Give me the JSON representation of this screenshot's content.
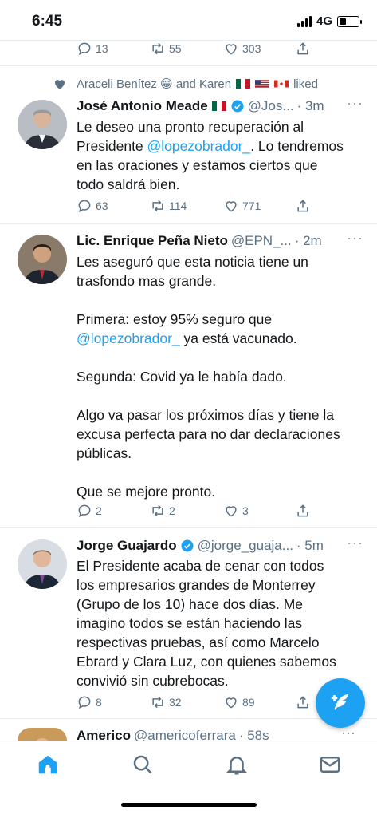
{
  "status": {
    "time": "6:45",
    "network": "4G"
  },
  "top_actions": {
    "replies": "13",
    "retweets": "55",
    "likes": "303"
  },
  "liked_banner": {
    "text_prefix": "Araceli Benítez 😁 and Karen",
    "text_suffix": "liked"
  },
  "tweets": [
    {
      "name": "José Antonio Meade",
      "handle": "@Jos...",
      "time": "· 3m",
      "body_1": "Le deseo una pronto recuperación al\nPresidente ",
      "mention_1": "@lopezobrador_",
      "body_2": ". Lo tendremos\nen las oraciones y estamos ciertos que\ntodo saldrá bien.",
      "replies": "63",
      "retweets": "114",
      "likes": "771"
    },
    {
      "name": "Lic. Enrique Peña Nieto",
      "handle": "@EPN_...",
      "time": "· 2m",
      "body_1": "Les aseguró que esta noticia tiene un\ntrasfondo mas grande.\n\nPrimera: estoy 95% seguro que\n",
      "mention_1": "@lopezobrador_",
      "body_2": " ya está vacunado.\n\nSegunda: Covid ya le había dado.\n\nAlgo va pasar los próximos días y tiene la\nexcusa perfecta para no dar declaraciones\npúblicas.\n\nQue se mejore pronto.",
      "replies": "2",
      "retweets": "2",
      "likes": "3"
    },
    {
      "name": "Jorge Guajardo",
      "handle": "@jorge_guaja...",
      "time": "· 5m",
      "body_1": "El Presidente acaba de cenar con todos\nlos empresarios grandes de Monterrey\n(Grupo de los 10) hace dos días. Me\nimagino todos se están haciendo las\nrespectivas pruebas, así como Marcelo\nEbrard y Clara Luz, con quienes sabemos\nconvivió sin cubrebocas.",
      "mention_1": "",
      "body_2": "",
      "replies": "8",
      "retweets": "32",
      "likes": "89"
    },
    {
      "name": "Americo",
      "handle": "@americoferrara",
      "time": "· 58s"
    }
  ],
  "colors": {
    "accent": "#1da1f2",
    "secondary_text": "#5b7083",
    "divider": "#e6ecf0"
  },
  "icons": [
    "reply-icon",
    "retweet-icon",
    "like-icon",
    "share-icon",
    "verified-icon",
    "compose-icon",
    "home-icon",
    "search-icon",
    "notifications-icon",
    "messages-icon"
  ]
}
